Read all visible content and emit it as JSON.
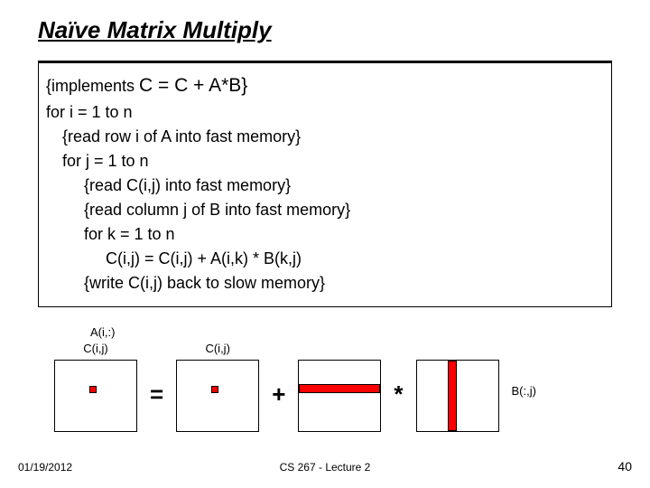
{
  "title": "Naïve Matrix Multiply",
  "code": {
    "l0a": "{implements ",
    "l0b": "C = C + A*B}",
    "l1": "for i = 1 to n",
    "l2": "{read row i of A into fast memory}",
    "l3": "for j = 1 to n",
    "l4": "{read C(i,j) into fast memory}",
    "l5": "{read column j of B into fast memory}",
    "l6": "for k = 1 to n",
    "l7": "C(i,j) = C(i,j) + A(i,k) * B(k,j)",
    "l8": "{write C(i,j) back to slow memory}"
  },
  "ops": {
    "eq": "=",
    "plus": "+",
    "star": "*"
  },
  "labels": {
    "c1": "C(i,j)",
    "c2": "C(i,j)",
    "a": "A(i,:)",
    "b": "B(:,j)"
  },
  "footer": {
    "date": "01/19/2012",
    "center": "CS 267 - Lecture 2",
    "num": "40"
  }
}
